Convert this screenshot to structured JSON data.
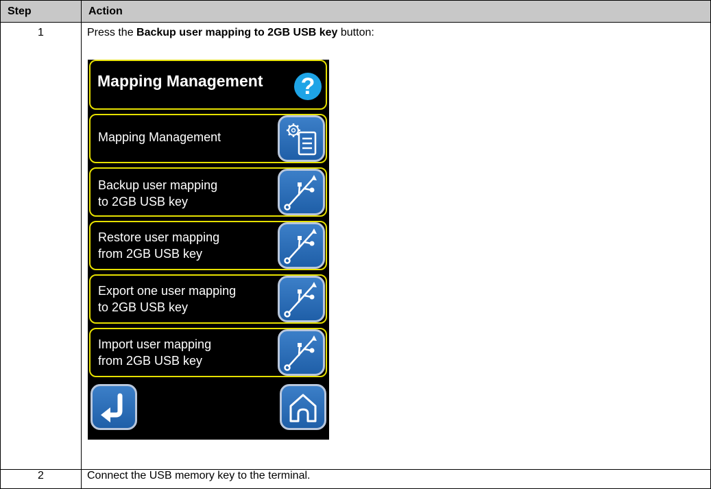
{
  "table": {
    "header_step": "Step",
    "header_action": "Action",
    "rows": [
      {
        "step": "1",
        "action_prefix": "Press the ",
        "action_bold": "Backup user mapping to 2GB USB key",
        "action_suffix": " button:"
      },
      {
        "step": "2",
        "action": "Connect the USB memory key to the terminal."
      }
    ]
  },
  "screen": {
    "title": "Mapping Management",
    "help_icon": "question-icon",
    "items": [
      {
        "line1": "Mapping Management",
        "line2": "",
        "icon": "settings-list-icon"
      },
      {
        "line1": "Backup user mapping",
        "line2": "to 2GB USB key",
        "icon": "usb-icon"
      },
      {
        "line1": "Restore user mapping",
        "line2": "from 2GB USB key",
        "icon": "usb-icon"
      },
      {
        "line1": "Export one user mapping",
        "line2": "to 2GB USB key",
        "icon": "usb-icon"
      },
      {
        "line1": "Import user mapping",
        "line2": "from 2GB USB key",
        "icon": "usb-icon"
      }
    ],
    "back_icon": "return-arrow-icon",
    "home_icon": "home-icon",
    "colors": {
      "panel_border": "#e6e000",
      "button_blue": "#2a6cb8",
      "help_blue": "#1ea4e6"
    }
  }
}
